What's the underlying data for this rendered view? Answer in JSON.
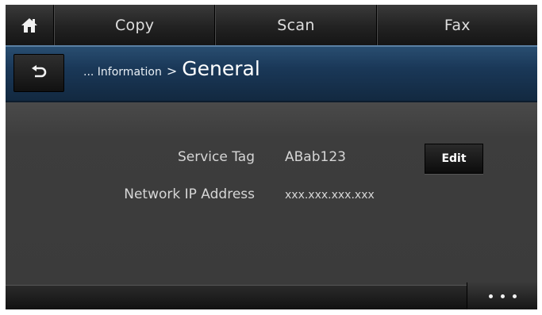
{
  "topbar": {
    "home_icon": "home-icon",
    "tabs": [
      {
        "label": "Copy"
      },
      {
        "label": "Scan"
      },
      {
        "label": "Fax"
      }
    ]
  },
  "titlebar": {
    "back_icon": "back-arrow-icon",
    "path": "... Information",
    "separator": ">",
    "current": "General"
  },
  "content": {
    "service_tag_label": "Service Tag",
    "service_tag_value": "ABab123",
    "edit_label": "Edit",
    "network_ip_label": "Network IP Address",
    "network_ip_value": "xxx.xxx.xxx.xxx"
  },
  "bottombar": {
    "more_icon": "more-dots-icon"
  },
  "colors": {
    "title_bar": "#1a3858",
    "content_bg": "#3b3b3b",
    "text": "#d6d6d6"
  }
}
